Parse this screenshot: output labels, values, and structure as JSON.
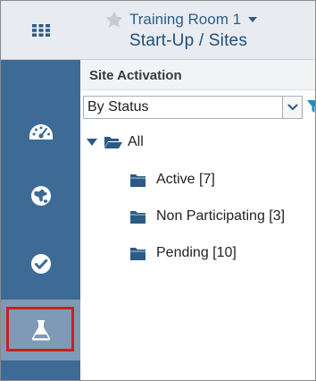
{
  "header": {
    "room_name": "Training Room 1",
    "page_title": "Start-Up / Sites"
  },
  "sidebar": {
    "items": [
      {
        "icon": "dashboard-icon",
        "active": false
      },
      {
        "icon": "globe-icon",
        "active": false
      },
      {
        "icon": "check-circle-icon",
        "active": false
      },
      {
        "icon": "flask-icon",
        "active": true
      }
    ]
  },
  "panel": {
    "title": "Site Activation",
    "group_by": {
      "selected": "By Status"
    }
  },
  "tree": {
    "root_label": "All",
    "children": [
      {
        "label": "Active [7]"
      },
      {
        "label": "Non Participating [3]"
      },
      {
        "label": "Pending [10]"
      }
    ]
  },
  "colors": {
    "header_bg": "#e8ecf1",
    "sidebar_bg": "#3e6b96",
    "sidebar_active_bg": "#7f9ab6",
    "highlight_border": "#c8211f",
    "title_blue": "#204e77",
    "folder_blue": "#2b5a85"
  }
}
